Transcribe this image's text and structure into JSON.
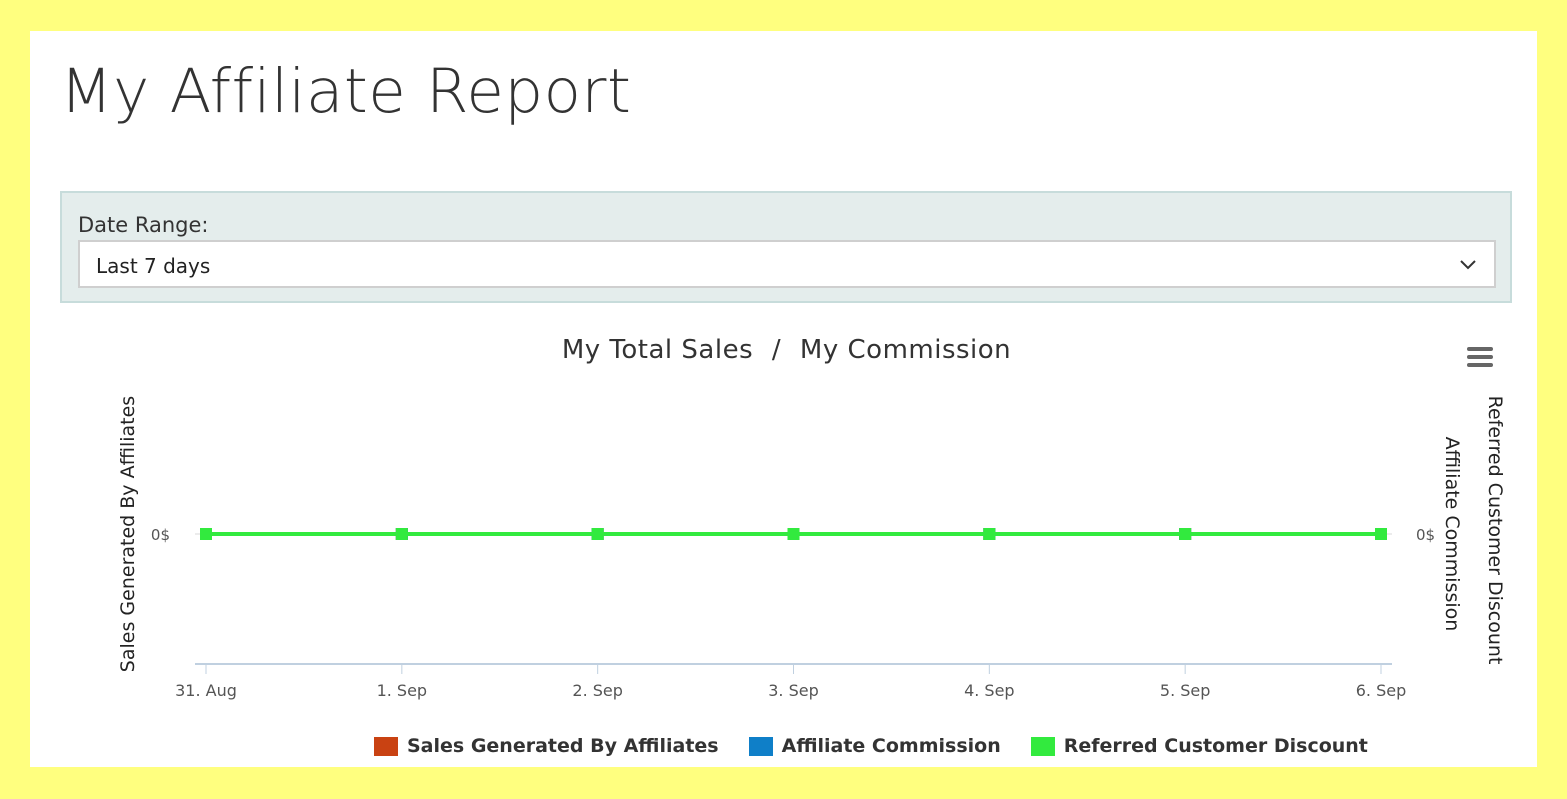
{
  "page": {
    "title": "My Affiliate Report"
  },
  "filter": {
    "label": "Date Range:",
    "selected": "Last 7 days"
  },
  "chart_menu_icon": "hamburger-menu-icon",
  "chart_data": {
    "type": "line",
    "title": "My Total Sales",
    "title_separator": "/",
    "title_secondary": "My Commission",
    "categories": [
      "31. Aug",
      "1. Sep",
      "2. Sep",
      "3. Sep",
      "4. Sep",
      "5. Sep",
      "6. Sep"
    ],
    "y_axis_left": {
      "label": "Sales Generated By Affiliates",
      "ticks": [
        "0$"
      ]
    },
    "y_axis_right": [
      {
        "label": "Affiliate Commission",
        "ticks": [
          "0$"
        ]
      },
      {
        "label": "Referred Customer Discount"
      }
    ],
    "series": [
      {
        "name": "Sales Generated By Affiliates",
        "color": "#c94212",
        "values": [
          0,
          0,
          0,
          0,
          0,
          0,
          0
        ]
      },
      {
        "name": "Affiliate Commission",
        "color": "#0f7fc8",
        "values": [
          0,
          0,
          0,
          0,
          0,
          0,
          0
        ]
      },
      {
        "name": "Referred Customer Discount",
        "color": "#32ea3e",
        "values": [
          0,
          0,
          0,
          0,
          0,
          0,
          0
        ]
      }
    ],
    "grid": false,
    "legend_position": "bottom-center"
  }
}
